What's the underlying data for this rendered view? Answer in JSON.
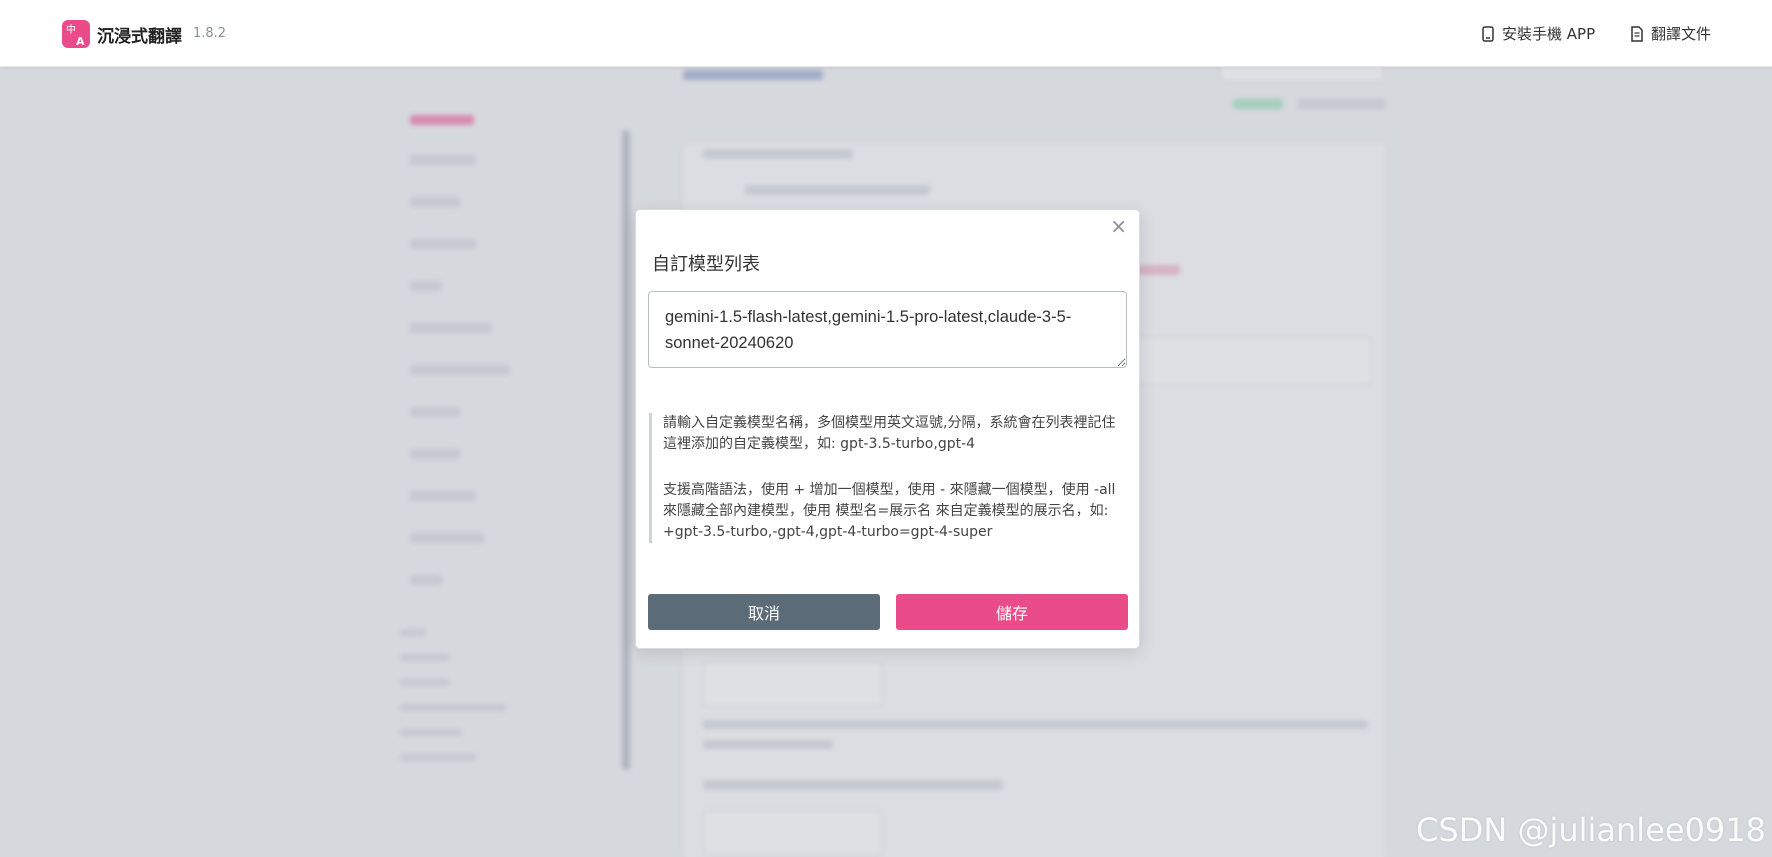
{
  "header": {
    "app_name": "沉浸式翻譯",
    "version": "1.8.2",
    "nav": [
      {
        "label": "安裝手機 APP",
        "icon": "phone-icon"
      },
      {
        "label": "翻譯文件",
        "icon": "document-icon"
      }
    ]
  },
  "modal": {
    "title": "自訂模型列表",
    "close_symbol": "×",
    "model_list_value": "gemini-1.5-flash-latest,gemini-1.5-pro-latest,claude-3-5-sonnet-20240620",
    "note_paragraph_1": "請輸入自定義模型名稱，多個模型用英文逗號,分隔，系統會在列表裡記住這裡添加的自定義模型，如: gpt-3.5-turbo,gpt-4",
    "note_paragraph_2": "支援高階語法，使用 + 增加一個模型，使用 - 來隱藏一個模型，使用 -all 來隱藏全部內建模型，使用 模型名=展示名 來自定義模型的展示名，如: +gpt-3.5-turbo,-gpt-4,gpt-4-turbo=gpt-4-super",
    "cancel_label": "取消",
    "save_label": "儲存"
  },
  "colors": {
    "accent": "#ea4c89",
    "cancel_button": "#5b6b78"
  },
  "watermark": "CSDN @julianlee0918"
}
